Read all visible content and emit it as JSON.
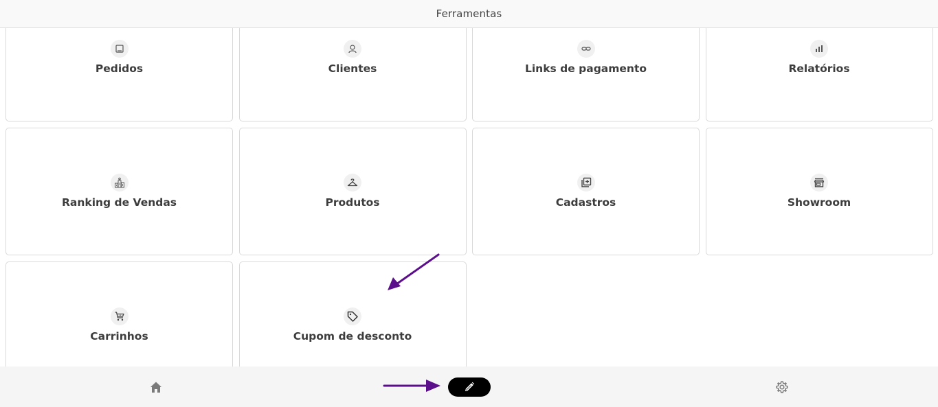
{
  "header": {
    "title": "Ferramentas"
  },
  "tools": [
    {
      "label": "Pedidos",
      "icon": "orders-icon"
    },
    {
      "label": "Clientes",
      "icon": "clients-icon"
    },
    {
      "label": "Links de pagamento",
      "icon": "payment-link-icon"
    },
    {
      "label": "Relatórios",
      "icon": "reports-icon"
    },
    {
      "label": "Ranking de Vendas",
      "icon": "ranking-icon"
    },
    {
      "label": "Produtos",
      "icon": "hanger-icon"
    },
    {
      "label": "Cadastros",
      "icon": "add-library-icon"
    },
    {
      "label": "Showroom",
      "icon": "store-icon"
    },
    {
      "label": "Carrinhos",
      "icon": "cart-icon"
    },
    {
      "label": "Cupom de desconto",
      "icon": "tag-icon"
    }
  ],
  "bottom_nav": {
    "items": [
      {
        "icon": "home-icon",
        "active": false
      },
      {
        "icon": "pencil-icon",
        "active": true
      },
      {
        "icon": "gear-icon",
        "active": false
      }
    ]
  },
  "annotations": {
    "arrow_color": "#5c0f8b"
  },
  "colors": {
    "header_bg": "#f9f9f9",
    "card_border": "#d9d9d9",
    "active_nav_bg": "#000000",
    "bottom_bar_bg": "#f5f5f5"
  }
}
